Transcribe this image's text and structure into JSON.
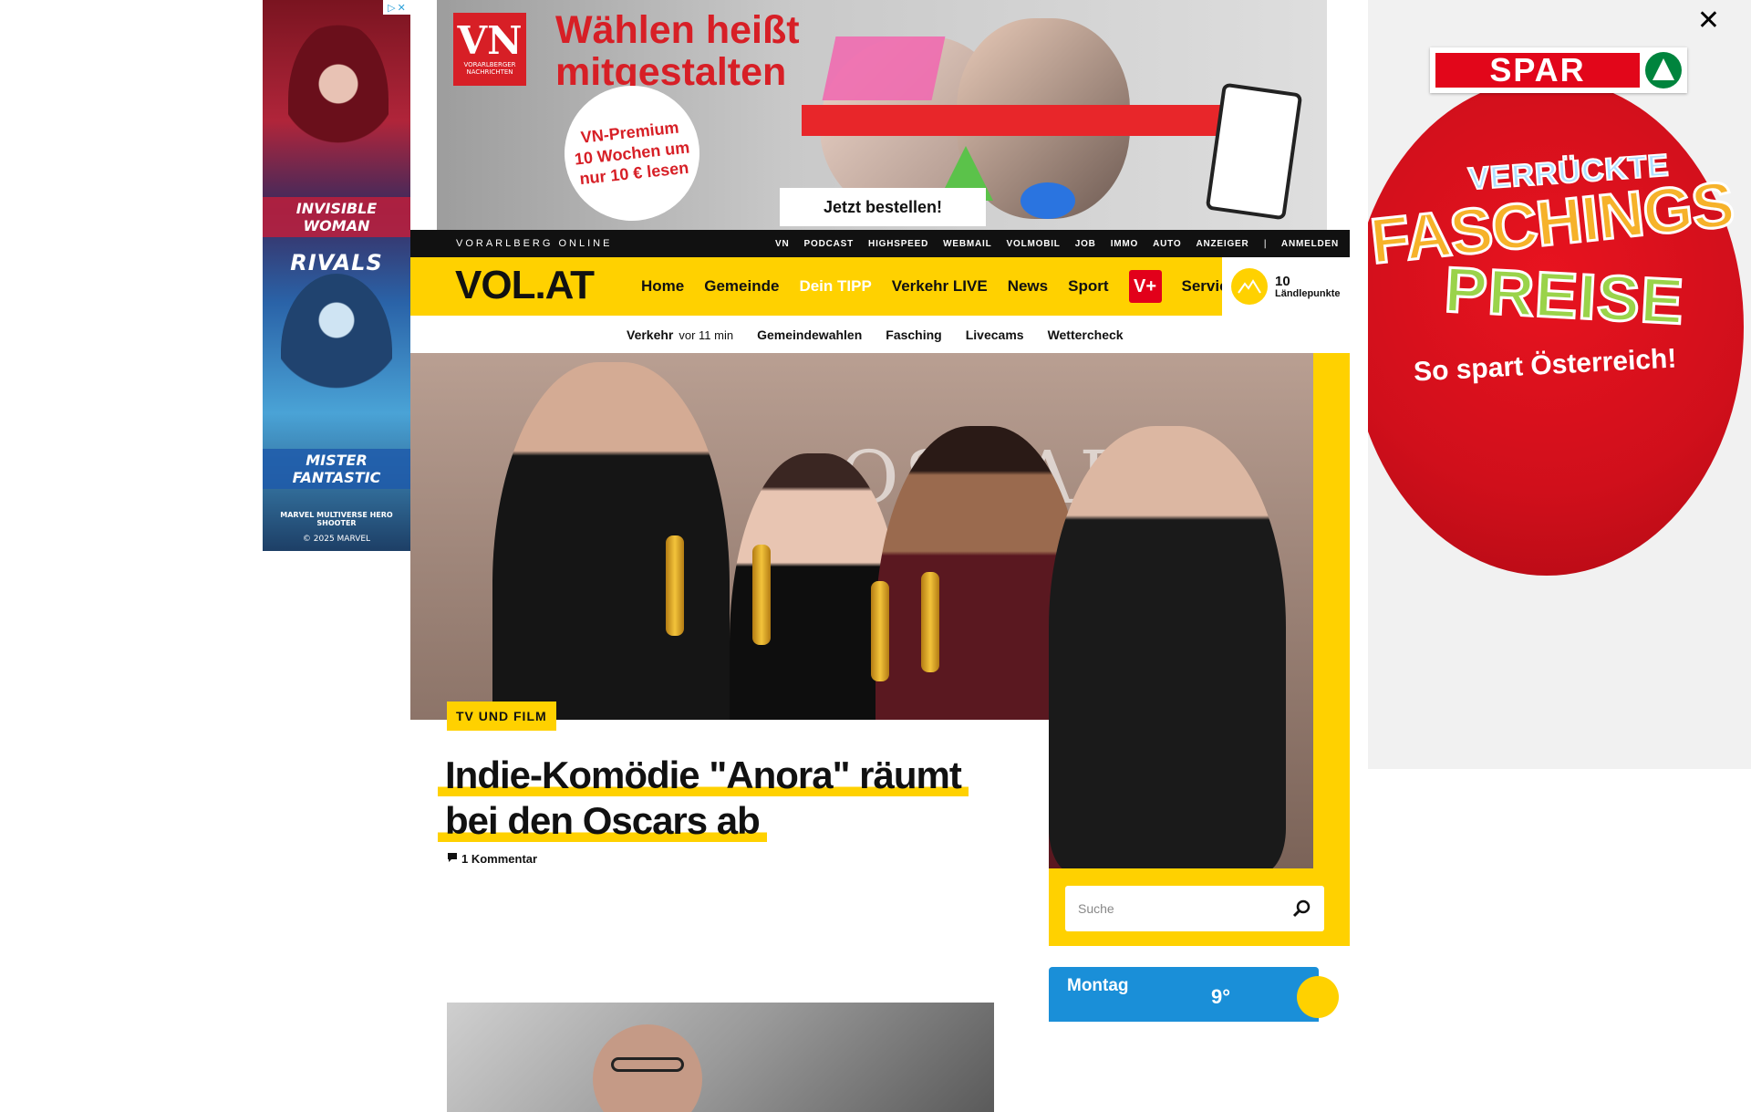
{
  "ad_left": {
    "character_top": "INVISIBLE WOMAN",
    "game_title": "RIVALS",
    "character_bottom": "MISTER FANTASTIC",
    "tagline": "MARVEL MULTIVERSE HERO SHOOTER",
    "copyright": "© 2025 MARVEL"
  },
  "ad_top": {
    "logo_big": "VN",
    "logo_sub": "VORARLBERGER NACHRICHTEN",
    "headline": "Wählen heißt mitgestalten",
    "badge": "VN-Premium 10 Wochen um nur 10 € lesen",
    "cta": "Jetzt bestellen!"
  },
  "ad_right": {
    "brand": "SPAR",
    "line1": "VERRÜCKTE",
    "line2": "FASCHINGS",
    "line3": "PREISE",
    "line4": "So spart Österreich!",
    "close": "✕"
  },
  "topbar": {
    "brand": "VORARLBERG ONLINE",
    "links": [
      "VN",
      "PODCAST",
      "HIGHSPEED",
      "WEBMAIL",
      "VOLMOBIL",
      "JOB",
      "IMMO",
      "AUTO",
      "ANZEIGER"
    ],
    "separator": "|",
    "login": "ANMELDEN"
  },
  "nav": {
    "logo": "VOL.AT",
    "items": [
      "Home",
      "Gemeinde",
      "Dein TIPP",
      "Verkehr LIVE",
      "News",
      "Sport"
    ],
    "vplus": "V+",
    "service": "Service",
    "points_value": "10",
    "points_label": "Ländlepunkte"
  },
  "subnav": {
    "traffic": "Verkehr",
    "traffic_time": "vor 11 min",
    "items": [
      "Gemeindewahlen",
      "Fasching",
      "Livecams",
      "Wettercheck"
    ]
  },
  "hero": {
    "photo_text": "OSCAR",
    "category": "TV UND FILM",
    "title_line1": "Indie-Komödie \"Anora\" räumt",
    "title_line2": "bei den Oscars ab",
    "comments": "1 Kommentar"
  },
  "search": {
    "placeholder": "Suche"
  },
  "weather": {
    "day": "Montag",
    "temp": "9°"
  },
  "colors": {
    "accent": "#ffd100",
    "dark": "#111111",
    "vplus": "#e2001a",
    "weather": "#1a8fd8"
  }
}
